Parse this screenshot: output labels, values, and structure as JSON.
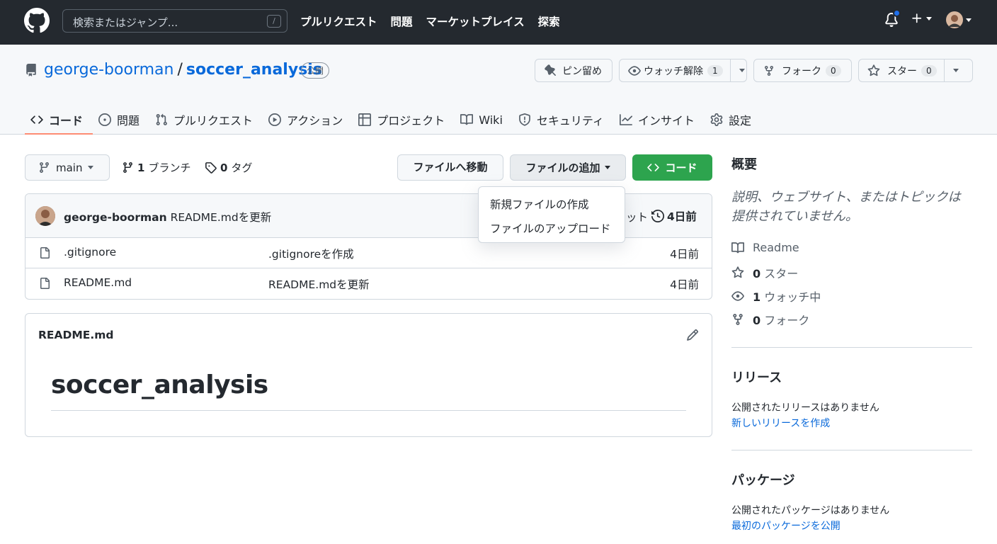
{
  "topbar": {
    "search_placeholder": "検索またはジャンプ...",
    "search_shortcut": "/",
    "nav": [
      "プルリクエスト",
      "問題",
      "マーケットプレイス",
      "探索"
    ]
  },
  "repo": {
    "owner": "george-boorman",
    "separator": "/",
    "name": "soccer_analysis",
    "visibility": "公開",
    "pin_label": "ピン留め",
    "watch_label": "ウォッチ解除",
    "watch_count": "1",
    "fork_label": "フォーク",
    "fork_count": "0",
    "star_label": "スター",
    "star_count": "0"
  },
  "tabs": [
    {
      "label": "コード",
      "icon": "code-icon"
    },
    {
      "label": "問題",
      "icon": "issue-icon"
    },
    {
      "label": "プルリクエスト",
      "icon": "pull-request-icon"
    },
    {
      "label": "アクション",
      "icon": "play-icon"
    },
    {
      "label": "プロジェクト",
      "icon": "table-icon"
    },
    {
      "label": "Wiki",
      "icon": "book-icon"
    },
    {
      "label": "セキュリティ",
      "icon": "shield-icon"
    },
    {
      "label": "インサイト",
      "icon": "graph-icon"
    },
    {
      "label": "設定",
      "icon": "gear-icon"
    }
  ],
  "toolbar": {
    "branch": "main",
    "branches_count": "1",
    "branches_label": "ブランチ",
    "tags_count": "0",
    "tags_label": "タグ",
    "goto_file": "ファイルへ移動",
    "add_file": "ファイルの追加",
    "code": "コード"
  },
  "add_file_menu": [
    "新規ファイルの作成",
    "ファイルのアップロード"
  ],
  "latest_commit": {
    "author": "george-boorman",
    "message": "README.mdを更新",
    "commits_fragment": "ット",
    "time": "4日前"
  },
  "files": [
    {
      "name": ".gitignore",
      "message": ".gitignoreを作成",
      "age": "4日前"
    },
    {
      "name": "README.md",
      "message": "README.mdを更新",
      "age": "4日前"
    }
  ],
  "readme": {
    "filename": "README.md",
    "heading": "soccer_analysis"
  },
  "sidebar": {
    "about_title": "概要",
    "about_desc": "説明、ウェブサイト、またはトピックは提供されていません。",
    "readme_label": "Readme",
    "stars_count": "0",
    "stars_label": "スター",
    "watching_count": "1",
    "watching_label": "ウォッチ中",
    "forks_count": "0",
    "forks_label": "フォーク",
    "releases_title": "リリース",
    "releases_empty": "公開されたリリースはありません",
    "releases_link": "新しいリリースを作成",
    "packages_title": "パッケージ",
    "packages_empty": "公開されたパッケージはありません",
    "packages_link": "最初のパッケージを公開"
  },
  "colors": {
    "header_bg": "#24292f",
    "link": "#0969da",
    "primary_button": "#2da44e",
    "active_tab_underline": "#fd8c73",
    "notification_dot": "#1f6feb"
  }
}
